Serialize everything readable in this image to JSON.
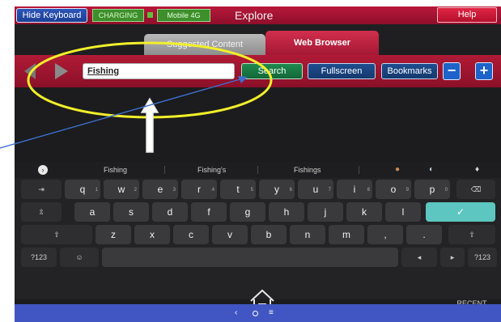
{
  "topbar": {
    "hide_keyboard": "Hide Keyboard",
    "charging": "CHARGING",
    "mobile": "Mobile 4G",
    "title": "Explore",
    "help": "Help"
  },
  "tabs": [
    {
      "label": "Suggested Content",
      "active": false
    },
    {
      "label": "Web Browser",
      "active": true
    }
  ],
  "browser": {
    "url_value": "Fishing",
    "search": "Search",
    "fullscreen": "Fullscreen",
    "bookmarks": "Bookmarks",
    "minus": "−",
    "plus": "+"
  },
  "keyboard": {
    "suggestions": [
      "Fishing",
      "Fishing's",
      "Fishings"
    ],
    "row1": [
      {
        "k": "q",
        "n": "1"
      },
      {
        "k": "w",
        "n": "2"
      },
      {
        "k": "e",
        "n": "3"
      },
      {
        "k": "r",
        "n": "4"
      },
      {
        "k": "t",
        "n": "5"
      },
      {
        "k": "y",
        "n": "6"
      },
      {
        "k": "u",
        "n": "7"
      },
      {
        "k": "i",
        "n": "8"
      },
      {
        "k": "o",
        "n": "9"
      },
      {
        "k": "p",
        "n": "0"
      }
    ],
    "row2": [
      "a",
      "s",
      "d",
      "f",
      "g",
      "h",
      "j",
      "k",
      "l"
    ],
    "row3": [
      "z",
      "x",
      "c",
      "v",
      "b",
      "n",
      "m",
      ",",
      "."
    ],
    "sym_left": "?123",
    "sym_right": "?123",
    "tab": "⇥",
    "backspace": "⌫",
    "caps": "⇫",
    "enter": "✓",
    "shift": "⇧",
    "emoji": "☺",
    "cursor_left": "◂",
    "cursor_right": "▸",
    "recent_apps": "RECENT APPS"
  },
  "colors": {
    "header_red": "#a51834",
    "search_green": "#1e8a4f",
    "button_blue": "#1f4e8f",
    "annotation_yellow": "#f2ef2a",
    "annotation_arrow": "#3d6fd1"
  }
}
